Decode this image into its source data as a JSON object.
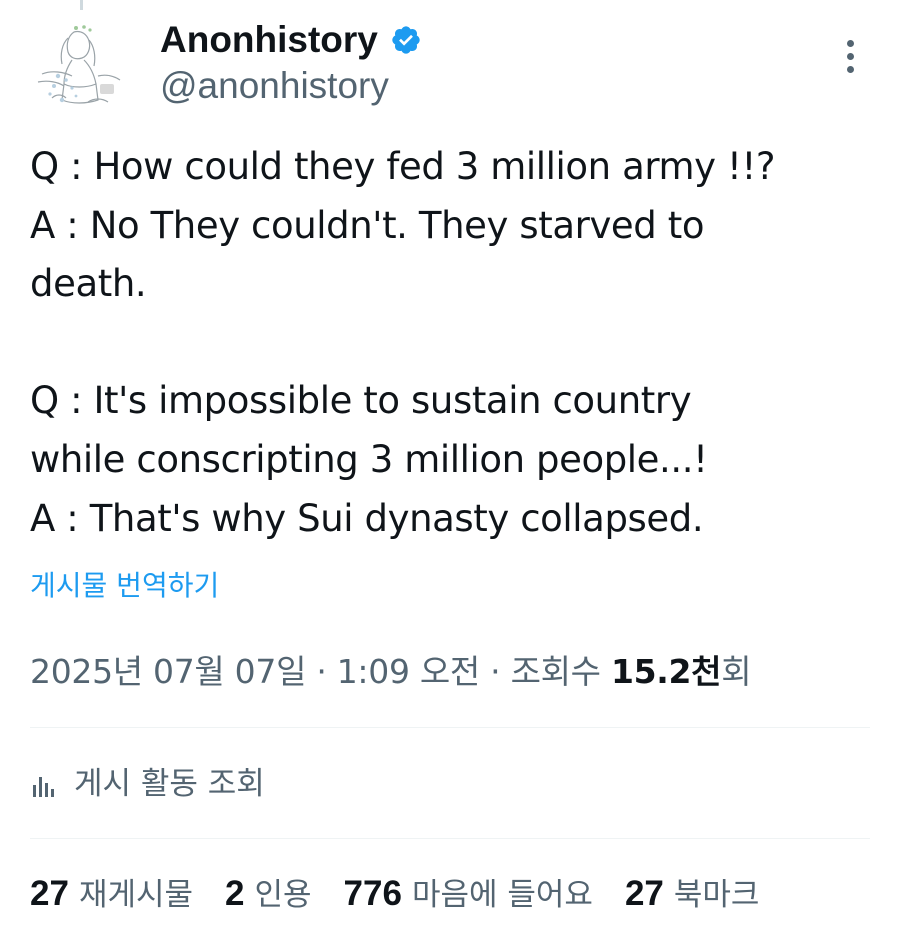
{
  "author": {
    "display_name": "Anonhistory",
    "handle": "@anonhistory",
    "verified": true,
    "verified_color": "#1d9bf0"
  },
  "tweet": {
    "text": "Q : How could they fed 3 million army !!?\nA : No They couldn't. They starved to\ndeath.\n\nQ : It's impossible to sustain country\nwhile conscripting 3 million people...!\nA : That's why Sui dynasty collapsed.",
    "translate_label": "게시물 번역하기"
  },
  "meta": {
    "date": "2025년 07월 07일",
    "separator": "·",
    "time": "1:09 오전",
    "views_label": "조회수",
    "views_count": "15.2천",
    "views_suffix": "회"
  },
  "activity": {
    "label": "게시 활동 조회",
    "icon": "analytics-icon"
  },
  "stats": [
    {
      "count": "27",
      "label": "재게시물"
    },
    {
      "count": "2",
      "label": "인용"
    },
    {
      "count": "776",
      "label": "마음에 들어요"
    },
    {
      "count": "27",
      "label": "북마크"
    }
  ],
  "colors": {
    "text_primary": "#0f1419",
    "text_secondary": "#536471",
    "link": "#1d9bf0",
    "divider": "#eff3f4"
  }
}
